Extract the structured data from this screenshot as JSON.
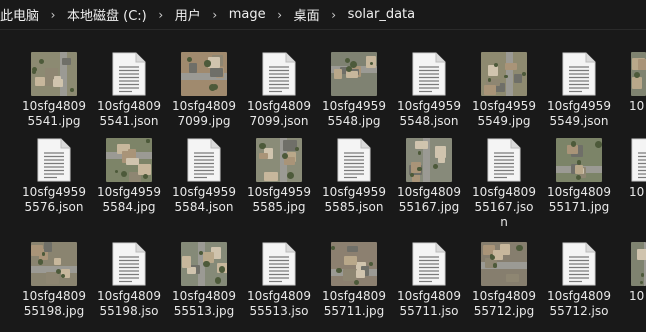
{
  "breadcrumb": {
    "items": [
      "此电脑",
      "本地磁盘 (C:)",
      "用户",
      "mage",
      "桌面",
      "solar_data"
    ]
  },
  "files": [
    {
      "name": "10sfg48095541.jpg",
      "lines": [
        "10sfg4809",
        "5541.jpg"
      ],
      "type": "photo",
      "tint": "#8c8a72"
    },
    {
      "name": "10sfg48095541.json",
      "lines": [
        "10sfg4809",
        "5541.json"
      ],
      "type": "doc"
    },
    {
      "name": "10sfg48097099.jpg",
      "lines": [
        "10sfg4809",
        "7099.jpg"
      ],
      "type": "photo",
      "tint": "#a08a6e"
    },
    {
      "name": "10sfg48097099.json",
      "lines": [
        "10sfg4809",
        "7099.json"
      ],
      "type": "doc"
    },
    {
      "name": "10sfg49595548.jpg",
      "lines": [
        "10sfg4959",
        "5548.jpg"
      ],
      "type": "photo",
      "tint": "#7f8272"
    },
    {
      "name": "10sfg49595548.json",
      "lines": [
        "10sfg4959",
        "5548.json"
      ],
      "type": "doc"
    },
    {
      "name": "10sfg49595549.jpg",
      "lines": [
        "10sfg4959",
        "5549.jpg"
      ],
      "type": "photo",
      "tint": "#8e8a70"
    },
    {
      "name": "10sfg49595549.json",
      "lines": [
        "10sfg4959",
        "5549.json"
      ],
      "type": "doc"
    },
    {
      "name": "10sfg49595576.json",
      "lines": [
        "10sfg4959",
        "5576.json"
      ],
      "type": "doc"
    },
    {
      "name": "10sfg49595584.jpg",
      "lines": [
        "10sfg4959",
        "5584.jpg"
      ],
      "type": "photo",
      "tint": "#7d8468"
    },
    {
      "name": "10sfg49595584.json",
      "lines": [
        "10sfg4959",
        "5584.json"
      ],
      "type": "doc"
    },
    {
      "name": "10sfg49595585.jpg",
      "lines": [
        "10sfg4959",
        "5585.jpg"
      ],
      "type": "photo",
      "tint": "#8a8c78"
    },
    {
      "name": "10sfg49595585.json",
      "lines": [
        "10sfg4959",
        "5585.json"
      ],
      "type": "doc"
    },
    {
      "name": "10sfg480955167.jpg",
      "lines": [
        "10sfg4809",
        "55167.jpg"
      ],
      "type": "photo",
      "tint": "#878a7a"
    },
    {
      "name": "10sfg480955167.json",
      "lines": [
        "10sfg4809",
        "55167.jso",
        "n"
      ],
      "type": "doc"
    },
    {
      "name": "10sfg480955171.jpg",
      "lines": [
        "10sfg4809",
        "55171.jpg"
      ],
      "type": "photo",
      "tint": "#7c8468"
    },
    {
      "name": "10sfg480955198.jpg",
      "lines": [
        "10sfg4809",
        "55198.jpg"
      ],
      "type": "photo",
      "tint": "#8a8470"
    },
    {
      "name": "10sfg480955198.json",
      "lines": [
        "10sfg4809",
        "55198.jso"
      ],
      "type": "doc"
    },
    {
      "name": "10sfg480955513.jpg",
      "lines": [
        "10sfg4809",
        "55513.jpg"
      ],
      "type": "photo",
      "tint": "#858a78"
    },
    {
      "name": "10sfg480955513.json",
      "lines": [
        "10sfg4809",
        "55513.jso"
      ],
      "type": "doc"
    },
    {
      "name": "10sfg480955711.jpg",
      "lines": [
        "10sfg4809",
        "55711.jpg"
      ],
      "type": "photo",
      "tint": "#8c8070"
    },
    {
      "name": "10sfg480955711.json",
      "lines": [
        "10sfg4809",
        "55711.jso"
      ],
      "type": "doc"
    },
    {
      "name": "10sfg480955712.jpg",
      "lines": [
        "10sfg4809",
        "55712.jpg"
      ],
      "type": "photo",
      "tint": "#867e6e"
    },
    {
      "name": "10sfg480955712.json",
      "lines": [
        "10sfg4809",
        "55712.jso"
      ],
      "type": "doc"
    }
  ],
  "partial_labels": {
    "row1": "10",
    "row2": "10",
    "row3": "10"
  },
  "colors": {
    "background": "#191919",
    "text": "#e8e8e8",
    "doc_fill": "#f4f4f4",
    "doc_line": "#7a7a7a"
  }
}
